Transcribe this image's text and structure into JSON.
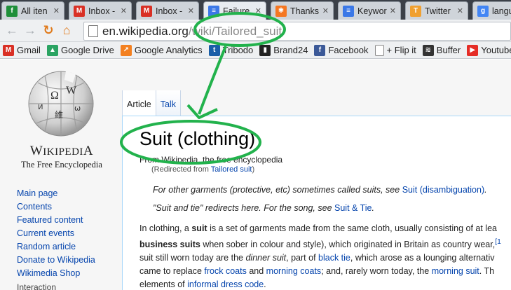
{
  "tabs": [
    {
      "label": "All iten",
      "favicon": "feedly-icon",
      "color": "#1f8f3a",
      "glyph": "f"
    },
    {
      "label": "Inbox -",
      "favicon": "gmail-icon",
      "color": "#d93025",
      "glyph": "M"
    },
    {
      "label": "Inbox -",
      "favicon": "gmail-icon",
      "color": "#d93025",
      "glyph": "M"
    },
    {
      "label": "Failure",
      "favicon": "docs-icon",
      "color": "#3b78e7",
      "glyph": "≡"
    },
    {
      "label": "Thanks",
      "favicon": "hubspot-icon",
      "color": "#f57722",
      "glyph": "✱"
    },
    {
      "label": "Keywor",
      "favicon": "docs-icon",
      "color": "#3b78e7",
      "glyph": "≡"
    },
    {
      "label": "Twitter",
      "favicon": "twitter-icon",
      "color": "#f0a030",
      "glyph": "T"
    },
    {
      "label": "languag",
      "favicon": "google-icon",
      "color": "#4285f4",
      "glyph": "g"
    }
  ],
  "address": {
    "host": "en.wikipedia.org",
    "path": "/wiki/Tailored_suit"
  },
  "bookmarks": [
    {
      "label": "Gmail",
      "icon": "gmail-icon",
      "color": "#d93025",
      "glyph": "M"
    },
    {
      "label": "Google Drive",
      "icon": "drive-icon",
      "color": "#2aa362",
      "glyph": "▲"
    },
    {
      "label": "Google Analytics",
      "icon": "analytics-icon",
      "color": "#f38020",
      "glyph": "↗"
    },
    {
      "label": "Tribodo",
      "icon": "tribodo-icon",
      "color": "#1a5fa8",
      "glyph": "t"
    },
    {
      "label": "Brand24",
      "icon": "brand24-icon",
      "color": "#222222",
      "glyph": "▮"
    },
    {
      "label": "Facebook",
      "icon": "facebook-icon",
      "color": "#3b5998",
      "glyph": "f"
    },
    {
      "label": "+ Flip it",
      "icon": "page-icon",
      "color": "#ffffff",
      "glyph": ""
    },
    {
      "label": "Buffer",
      "icon": "buffer-icon",
      "color": "#333333",
      "glyph": "≋"
    },
    {
      "label": "Youtube",
      "icon": "youtube-icon",
      "color": "#e52d27",
      "glyph": "▶"
    }
  ],
  "logo": {
    "wordmark": "Wikipedia",
    "tagline": "The Free Encyclopedia"
  },
  "sidenav": {
    "links": [
      "Main page",
      "Contents",
      "Featured content",
      "Current events",
      "Random article",
      "Donate to Wikipedia",
      "Wikimedia Shop"
    ],
    "section": "Interaction"
  },
  "page_tabs": {
    "article": "Article",
    "talk": "Talk"
  },
  "article": {
    "title": "Suit (clothing)",
    "site_sub": "From Wikipedia, the free encyclopedia",
    "redirect_prefix": "(Redirected from ",
    "redirect_link": "Tailored suit",
    "redirect_suffix": ")",
    "hatnote1_text": "For other garments (protective, etc) sometimes called suits, see ",
    "hatnote1_link": "Suit (disambiguation)",
    "hatnote1_end": ".",
    "hatnote2_text": "\"Suit and tie\" redirects here. For the song, see ",
    "hatnote2_link": "Suit & Tie",
    "hatnote2_end": ".",
    "p1": "In clothing, a ",
    "p1_bold": "suit",
    "p1_rest": " is a set of garments made from the same cloth, usually consisting of at lea",
    "p2_bold": "business suits",
    "p2_rest": " when sober in colour and style), which originated in Britain as country wear,",
    "p2_ref": "[1",
    "p3": "suit still worn today are the ",
    "p3_italic": "dinner suit",
    "p3_mid": ", part of ",
    "p3_link": "black tie",
    "p3_rest": ", which arose as a lounging alternativ",
    "p4": "came to replace ",
    "p4_link1": "frock coats",
    "p4_mid": " and ",
    "p4_link2": "morning coats",
    "p4_mid2": "; and, rarely worn today, the ",
    "p4_link3": "morning suit",
    "p4_end": ". Th",
    "p5": "elements of ",
    "p5_link": "informal dress code",
    "p5_end": "."
  }
}
